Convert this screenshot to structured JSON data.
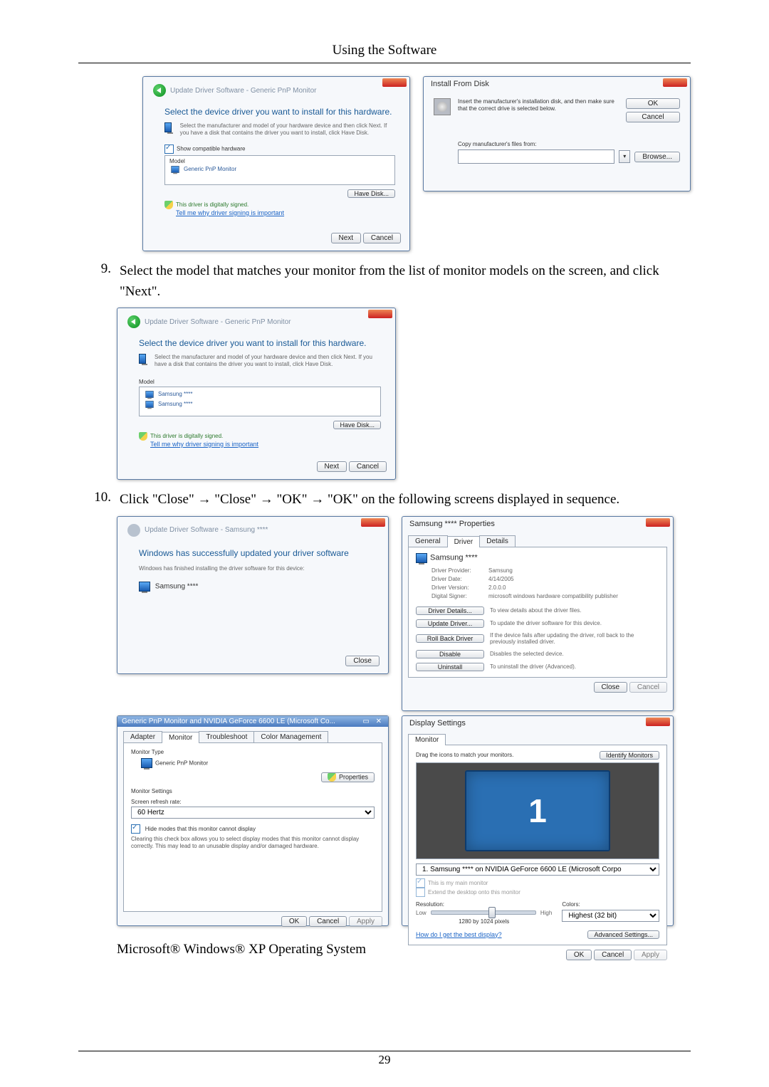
{
  "doc": {
    "header_title": "Using the Software",
    "page_number": "29",
    "step9_num": "9.",
    "step9_text": "Select the model that matches your monitor from the list of monitor models on the screen, and click \"Next\".",
    "step10_num": "10.",
    "step10_text": "Click \"Close\" → \"Close\" → \"OK\" → \"OK\" on the following screens displayed in sequence.",
    "footer_line": "Microsoft® Windows® XP Operating System"
  },
  "wizA": {
    "crumb": "Update Driver Software - Generic PnP Monitor",
    "heading": "Select the device driver you want to install for this hardware.",
    "sub": "Select the manufacturer and model of your hardware device and then click Next. If you have a disk that contains the driver you want to install, click Have Disk.",
    "compat": "Show compatible hardware",
    "col_model": "Model",
    "row1": "Generic PnP Monitor",
    "signed": "This driver is digitally signed.",
    "tell": "Tell me why driver signing is important",
    "have_disk": "Have Disk...",
    "next": "Next",
    "cancel": "Cancel"
  },
  "installDisk": {
    "title": "Install From Disk",
    "msg": "Insert the manufacturer's installation disk, and then make sure that the correct drive is selected below.",
    "ok": "OK",
    "cancel": "Cancel",
    "copy_label": "Copy manufacturer's files from:",
    "browse": "Browse..."
  },
  "wizC": {
    "crumb": "Update Driver Software - Generic PnP Monitor",
    "heading": "Select the device driver you want to install for this hardware.",
    "sub": "Select the manufacturer and model of your hardware device and then click Next. If you have a disk that contains the driver you want to install, click Have Disk.",
    "col_model": "Model",
    "row1": "Samsung ****",
    "row2": "Samsung ****",
    "signed": "This driver is digitally signed.",
    "tell": "Tell me why driver signing is important",
    "have_disk": "Have Disk...",
    "next": "Next",
    "cancel": "Cancel"
  },
  "wizD": {
    "crumb": "Update Driver Software - Samsung ****",
    "heading": "Windows has successfully updated your driver software",
    "sub": "Windows has finished installing the driver software for this device:",
    "device": "Samsung ****",
    "close": "Close"
  },
  "prop": {
    "title": "Samsung **** Properties",
    "tab_general": "General",
    "tab_driver": "Driver",
    "tab_details": "Details",
    "name": "Samsung ****",
    "lbl_provider": "Driver Provider:",
    "val_provider": "Samsung",
    "lbl_date": "Driver Date:",
    "val_date": "4/14/2005",
    "lbl_version": "Driver Version:",
    "val_version": "2.0.0.0",
    "lbl_signer": "Digital Signer:",
    "val_signer": "microsoft windows hardware compatibility publisher",
    "btn_details": "Driver Details...",
    "txt_details": "To view details about the driver files.",
    "btn_update": "Update Driver...",
    "txt_update": "To update the driver software for this device.",
    "btn_rollback": "Roll Back Driver",
    "txt_rollback": "If the device fails after updating the driver, roll back to the previously installed driver.",
    "btn_disable": "Disable",
    "txt_disable": "Disables the selected device.",
    "btn_uninstall": "Uninstall",
    "txt_uninstall": "To uninstall the driver (Advanced).",
    "close": "Close",
    "cancel": "Cancel"
  },
  "monProp": {
    "title": "Generic PnP Monitor and NVIDIA GeForce 6600 LE (Microsoft Co...",
    "tab_adapter": "Adapter",
    "tab_monitor": "Monitor",
    "tab_trouble": "Troubleshoot",
    "tab_color": "Color Management",
    "grp_type": "Monitor Type",
    "type_name": "Generic PnP Monitor",
    "btn_props": "Properties",
    "grp_settings": "Monitor Settings",
    "lbl_refresh": "Screen refresh rate:",
    "val_refresh": "60 Hertz",
    "chk_hide": "Hide modes that this monitor cannot display",
    "hide_desc": "Clearing this check box allows you to select display modes that this monitor cannot display correctly. This may lead to an unusable display and/or damaged hardware.",
    "ok": "OK",
    "cancel": "Cancel",
    "apply": "Apply"
  },
  "dispSet": {
    "title": "Display Settings",
    "tab_monitor": "Monitor",
    "drag": "Drag the icons to match your monitors.",
    "identify": "Identify Monitors",
    "number": "1",
    "selected": "1. Samsung **** on NVIDIA GeForce 6600 LE (Microsoft Corpo",
    "chk_main": "This is my main monitor",
    "chk_extend": "Extend the desktop onto this monitor",
    "lbl_res": "Resolution:",
    "res_low": "Low",
    "res_high": "High",
    "res_value": "1280 by 1024 pixels",
    "lbl_colors": "Colors:",
    "colors_value": "Highest (32 bit)",
    "link_best": "How do I get the best display?",
    "adv": "Advanced Settings...",
    "ok": "OK",
    "cancel": "Cancel",
    "apply": "Apply"
  }
}
